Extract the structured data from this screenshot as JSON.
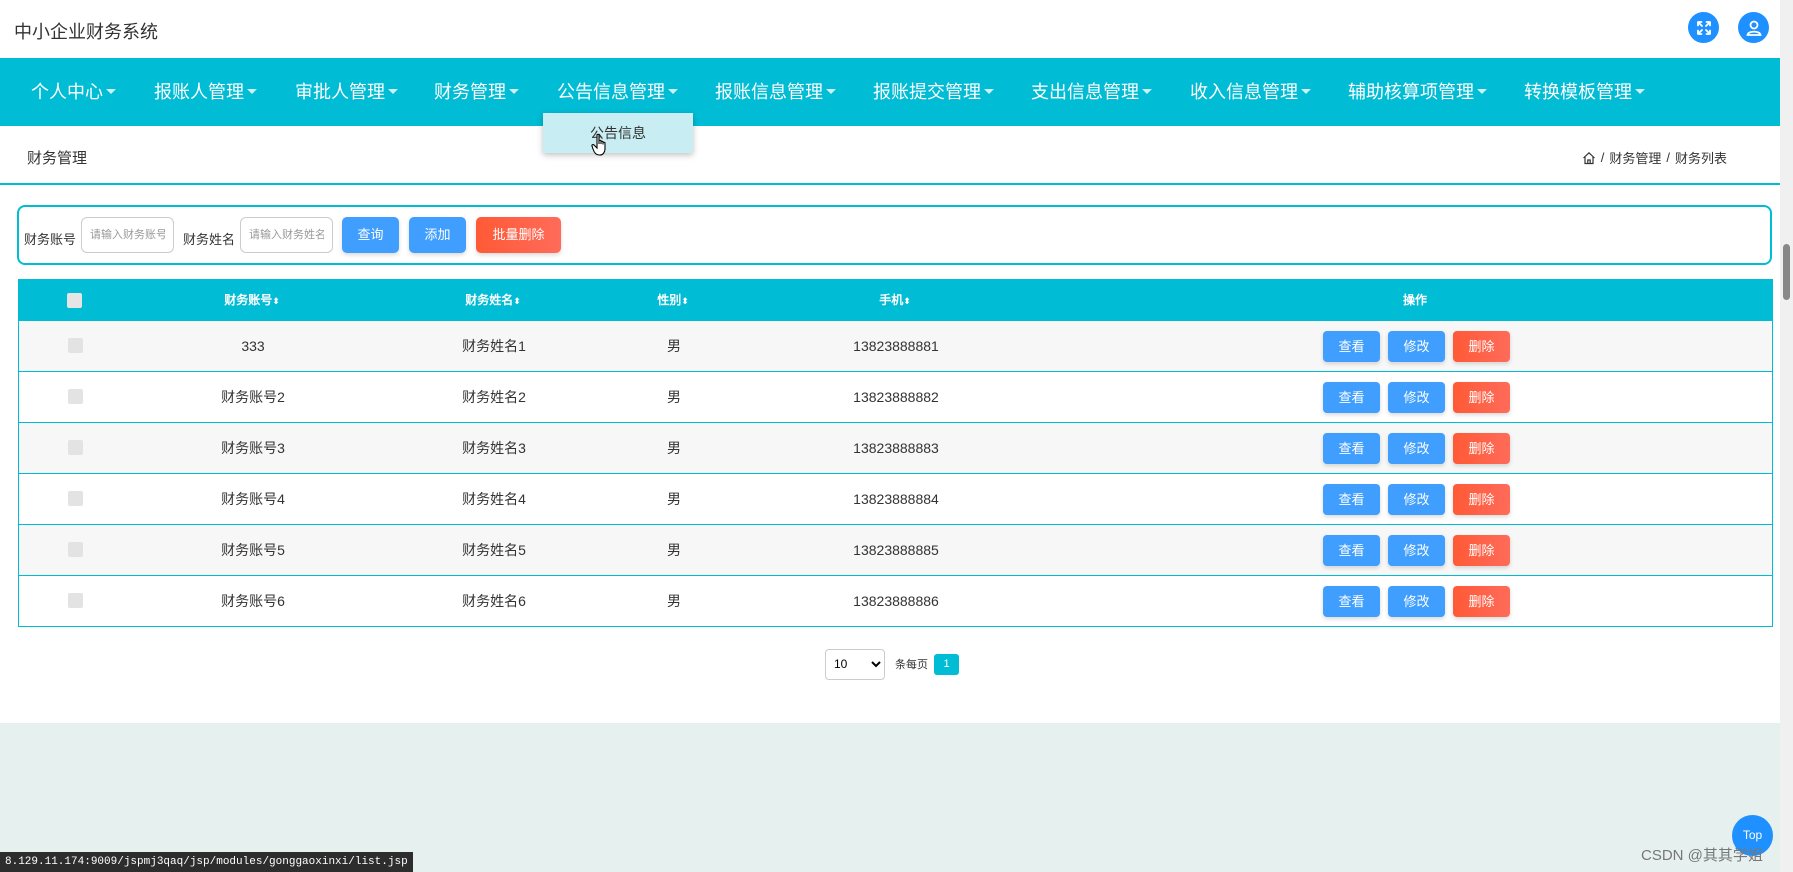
{
  "app": {
    "title": "中小企业财务系统"
  },
  "nav": {
    "items": [
      {
        "label": "个人中心"
      },
      {
        "label": "报账人管理"
      },
      {
        "label": "审批人管理"
      },
      {
        "label": "财务管理"
      },
      {
        "label": "公告信息管理"
      },
      {
        "label": "报账信息管理"
      },
      {
        "label": "报账提交管理"
      },
      {
        "label": "支出信息管理"
      },
      {
        "label": "收入信息管理"
      },
      {
        "label": "辅助核算项管理"
      },
      {
        "label": "转换模板管理"
      }
    ],
    "open_dropdown": {
      "items": [
        {
          "label": "公告信息"
        }
      ]
    }
  },
  "page": {
    "title": "财务管理",
    "breadcrumb": [
      "/",
      "财务管理",
      "/",
      "财务列表"
    ]
  },
  "search": {
    "account_label": "财务账号",
    "account_placeholder": "请输入财务账号",
    "name_label": "财务姓名",
    "name_placeholder": "请输入财务姓名",
    "query_button": "查询",
    "add_button": "添加",
    "batch_delete_button": "批量删除"
  },
  "table": {
    "columns": [
      {
        "label": "财务账号",
        "sort": "⬍"
      },
      {
        "label": "财务姓名",
        "sort": "⬍"
      },
      {
        "label": "性别",
        "sort": "⬍"
      },
      {
        "label": "手机",
        "sort": "⬍"
      },
      {
        "label": "操作"
      }
    ],
    "rows": [
      {
        "account": "333",
        "name": "财务姓名1",
        "gender": "男",
        "phone": "13823888881"
      },
      {
        "account": "财务账号2",
        "name": "财务姓名2",
        "gender": "男",
        "phone": "13823888882"
      },
      {
        "account": "财务账号3",
        "name": "财务姓名3",
        "gender": "男",
        "phone": "13823888883"
      },
      {
        "account": "财务账号4",
        "name": "财务姓名4",
        "gender": "男",
        "phone": "13823888884"
      },
      {
        "account": "财务账号5",
        "name": "财务姓名5",
        "gender": "男",
        "phone": "13823888885"
      },
      {
        "account": "财务账号6",
        "name": "财务姓名6",
        "gender": "男",
        "phone": "13823888886"
      }
    ],
    "row_actions": {
      "view": "查看",
      "edit": "修改",
      "delete": "删除"
    }
  },
  "pagination": {
    "page_size": "10",
    "per_page_label": "条每页",
    "current_page": "1"
  },
  "status_url": "8.129.11.174:9009/jspmj3qaq/jsp/modules/gonggaoxinxi/list.jsp",
  "back_to_top": "Top",
  "watermark": "CSDN @其其学姐",
  "colors": {
    "primary": "#00bcd4",
    "button_blue": "#409eff",
    "button_red": "#ff5a36",
    "icon_blue": "#1e90ff"
  },
  "icons": {
    "fullscreen": "fullscreen-icon",
    "user": "user-icon",
    "home": "home-icon"
  }
}
